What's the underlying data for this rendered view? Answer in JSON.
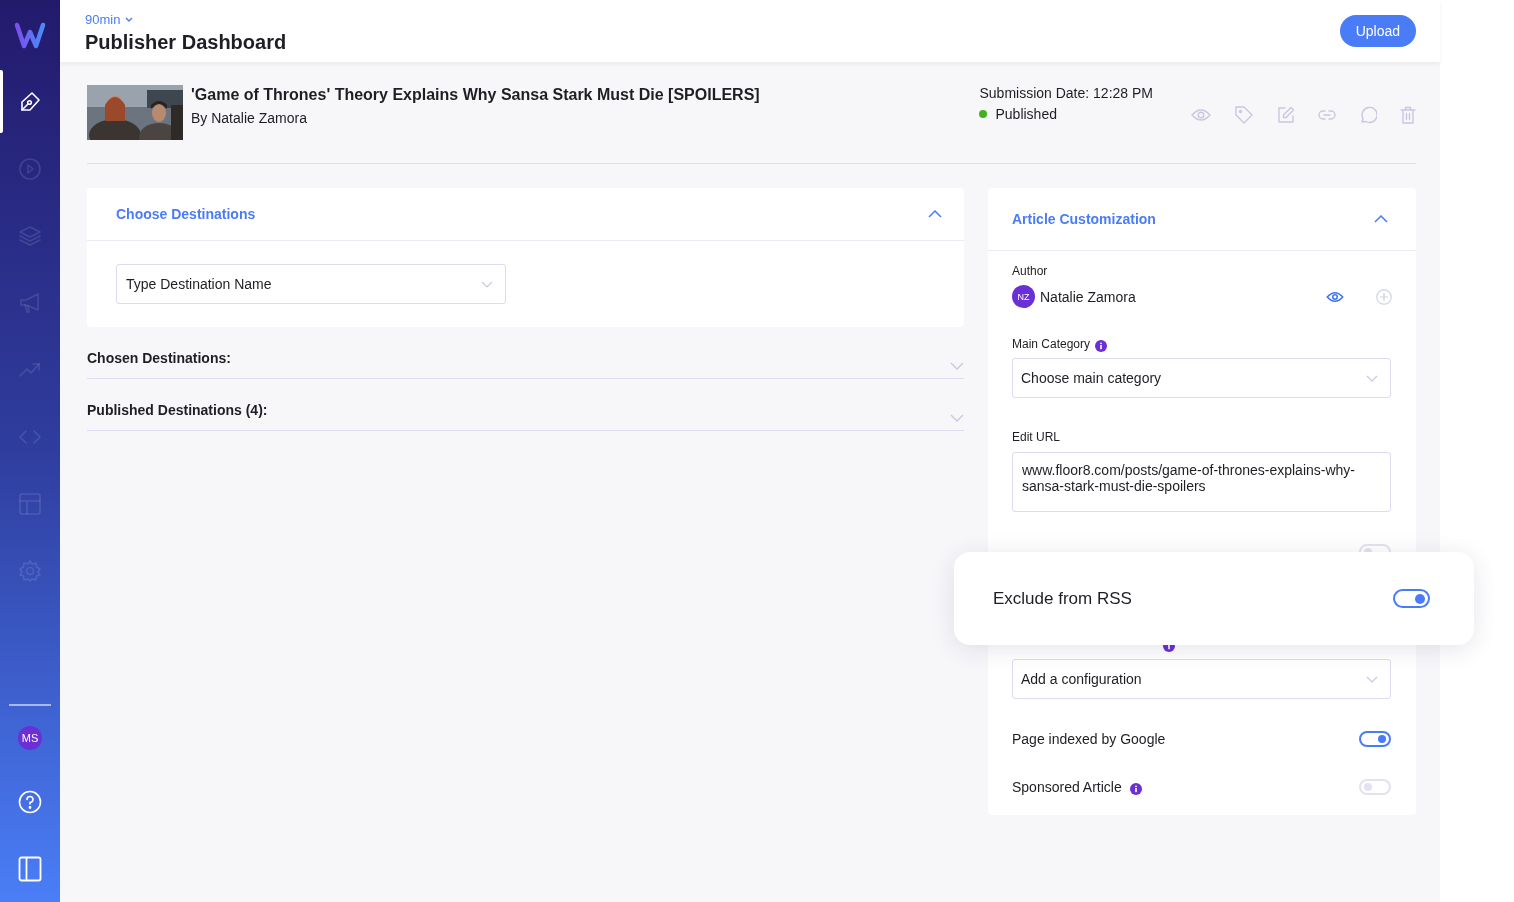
{
  "sidebar": {
    "items": [
      {
        "selected": true
      },
      {
        "selected": false
      },
      {
        "selected": false
      },
      {
        "selected": false
      },
      {
        "selected": false
      },
      {
        "selected": false
      },
      {
        "selected": false
      },
      {
        "selected": false
      }
    ],
    "user_avatar": "MS"
  },
  "header": {
    "publisher": "90min",
    "title": "Publisher Dashboard",
    "upload_button": "Upload"
  },
  "article": {
    "title": "'Game of Thrones' Theory Explains Why Sansa Stark Must Die [SPOILERS]",
    "byline": "By Natalie Zamora",
    "submission": "Submission Date: 12:28 PM",
    "status": "Published"
  },
  "destinations": {
    "title": "Choose Destinations",
    "expanded": true,
    "field": {
      "placeholder": "Type Destination Name"
    },
    "sections": [
      {
        "label": "Chosen Destinations:",
        "expanded": false
      },
      {
        "label": "Published Destinations (4):",
        "expanded": false
      }
    ]
  },
  "customization": {
    "title": "Article Customization",
    "expanded": true,
    "author": {
      "label": "Author",
      "initials": "NZ",
      "name": "Natalie Zamora"
    },
    "main_category": {
      "label": "Main Category",
      "placeholder": "Choose main category"
    },
    "edit_url": {
      "label": "Edit URL",
      "value": "www.floor8.com/posts/game-of-thrones-explains-why-sansa-stark-must-die-spoilers"
    },
    "canonical_url": {
      "on": false
    },
    "commercial": {
      "placeholder": "Add a configuration"
    },
    "toggles": [
      {
        "label": "Page indexed by Google",
        "on": true,
        "info": false
      },
      {
        "label": "Sponsored Article",
        "on": false,
        "info": true
      }
    ]
  },
  "popover": {
    "label": "Exclude from RSS",
    "on": true
  }
}
